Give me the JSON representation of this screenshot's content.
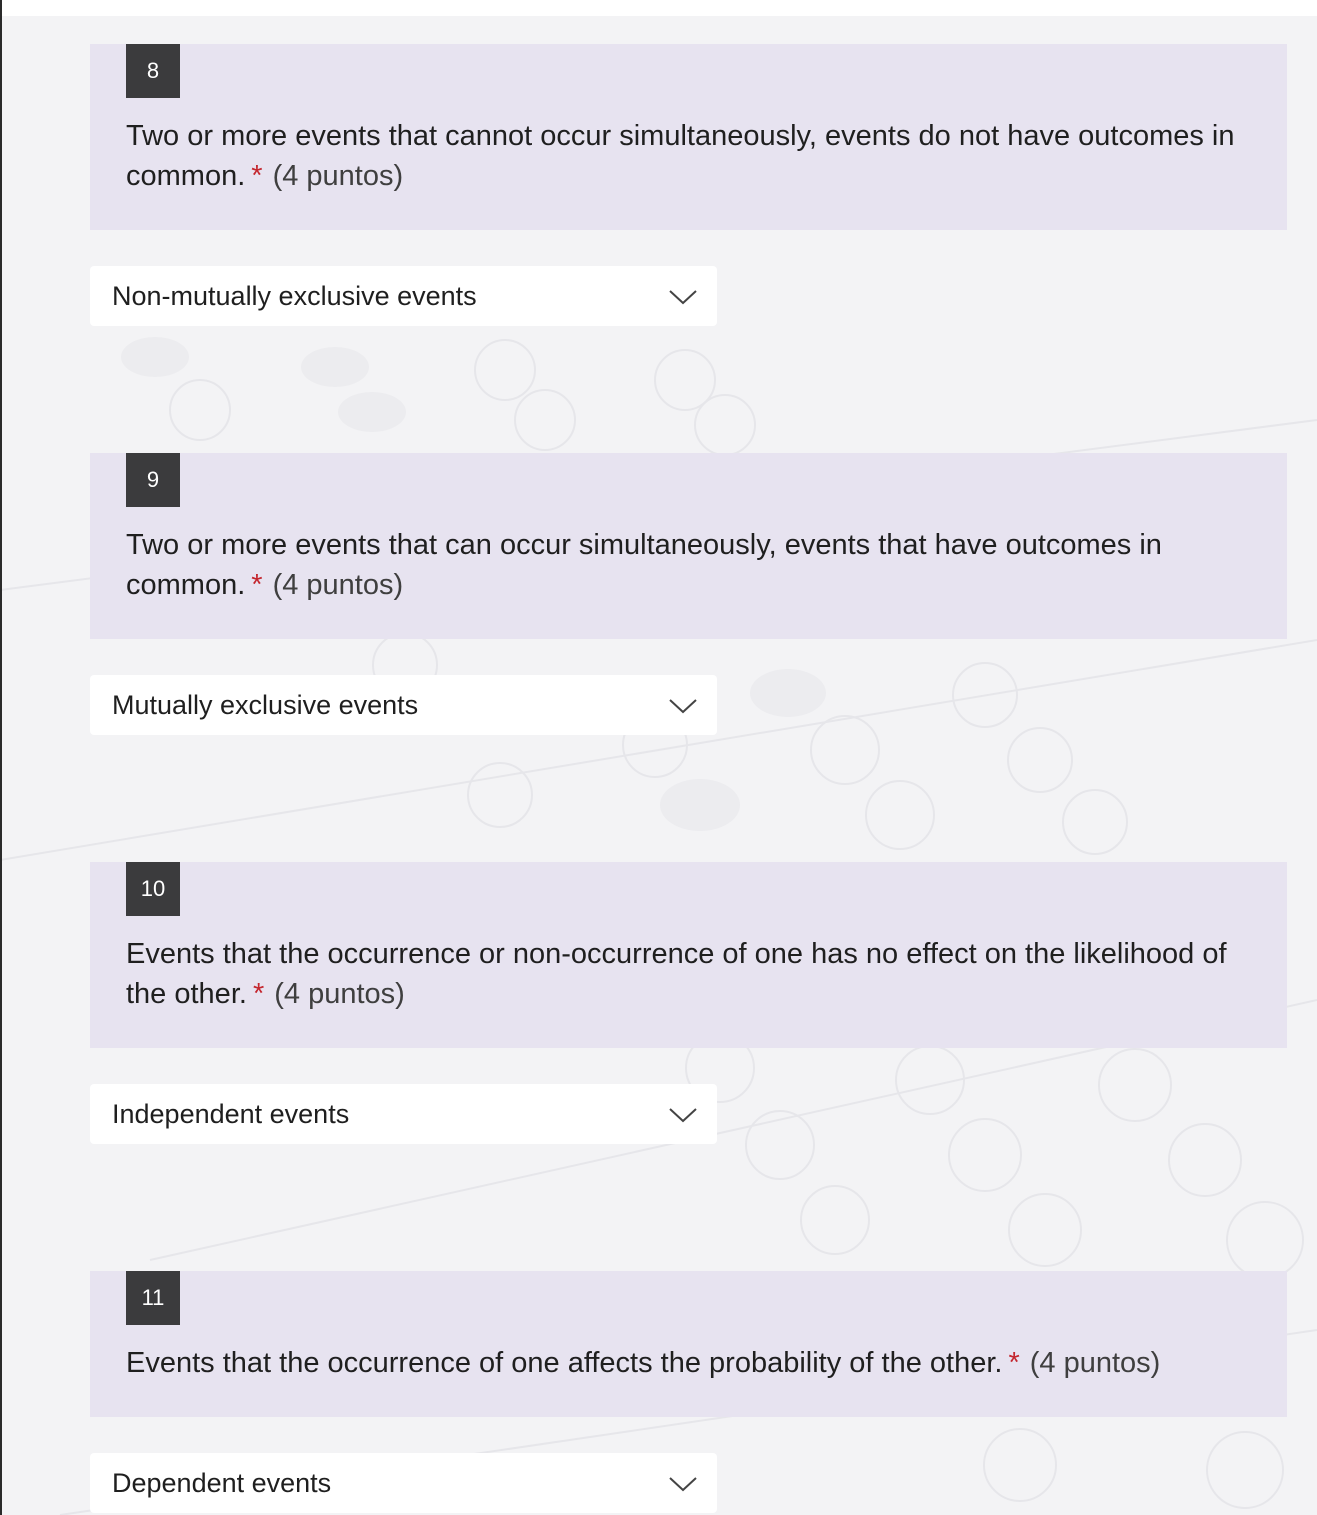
{
  "questions": [
    {
      "number": "8",
      "text": "Two or more events that cannot occur simultaneously, events do not have outcomes in common.",
      "required_mark": "*",
      "points": "(4 puntos)",
      "answer": "Non-mutually exclusive events"
    },
    {
      "number": "9",
      "text": "Two or more events that can occur simultaneously, events that have outcomes in common.",
      "required_mark": "*",
      "points": "(4 puntos)",
      "answer": "Mutually exclusive events"
    },
    {
      "number": "10",
      "text": "Events that the occurrence or non-occurrence of one has no effect on the likelihood of the other.",
      "required_mark": "*",
      "points": "(4 puntos)",
      "answer": "Independent events"
    },
    {
      "number": "11",
      "text": "Events that the occurrence of one affects the probability of the other.",
      "required_mark": "*",
      "points": "(4 puntos)",
      "answer": "Dependent events"
    }
  ],
  "colors": {
    "question_bg": "#e7e3f0",
    "number_badge": "#3b3b3d",
    "required": "#c4262e",
    "dropdown_bg": "#ffffff"
  },
  "icons": {
    "dropdown": "chevron-down-icon"
  }
}
